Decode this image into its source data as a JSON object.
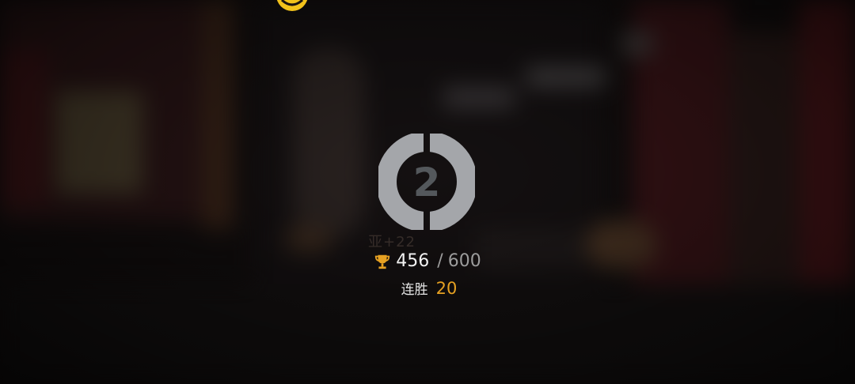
{
  "top_icon": {
    "name": "character-face-icon",
    "color": "#f2c21b"
  },
  "rank": {
    "number": "2",
    "ring_color": "#a4a6aa",
    "number_color": "#54585c"
  },
  "ghost_text": "亚+22",
  "score": {
    "icon": "trophy-icon",
    "icon_color": "#e6a122",
    "current": "456",
    "separator": "/",
    "max": "600"
  },
  "streak": {
    "label": "连胜",
    "value": "20",
    "value_color": "#e6a122"
  }
}
